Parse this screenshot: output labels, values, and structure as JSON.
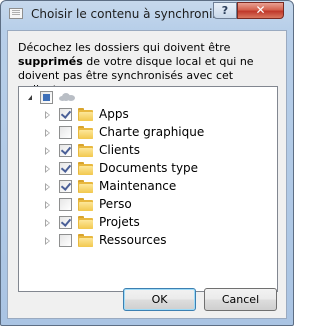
{
  "window": {
    "title": "Choisir le contenu à synchroniser",
    "help_label": "?",
    "close_label": "✕"
  },
  "description": {
    "before": "Décochez les dossiers qui doivent être ",
    "bold": "supprimés",
    "after": " de votre disque local et qui ne doivent pas être synchronisés avec cet ordinateur."
  },
  "tree": {
    "root": {
      "icon": "cloud-icon",
      "state": "partial",
      "expanded": true
    },
    "items": [
      {
        "label": "Apps",
        "checked": true
      },
      {
        "label": "Charte graphique",
        "checked": false
      },
      {
        "label": "Clients",
        "checked": true
      },
      {
        "label": "Documents type",
        "checked": true
      },
      {
        "label": "Maintenance",
        "checked": true
      },
      {
        "label": "Perso",
        "checked": false
      },
      {
        "label": "Projets",
        "checked": true
      },
      {
        "label": "Ressources",
        "checked": false
      }
    ]
  },
  "buttons": {
    "ok": "OK",
    "cancel": "Cancel"
  },
  "colors": {
    "title_bar": "#b8cfe9",
    "close_button": "#c0382a",
    "folder": "#f2c84e",
    "checkmark": "#4a5f97"
  }
}
